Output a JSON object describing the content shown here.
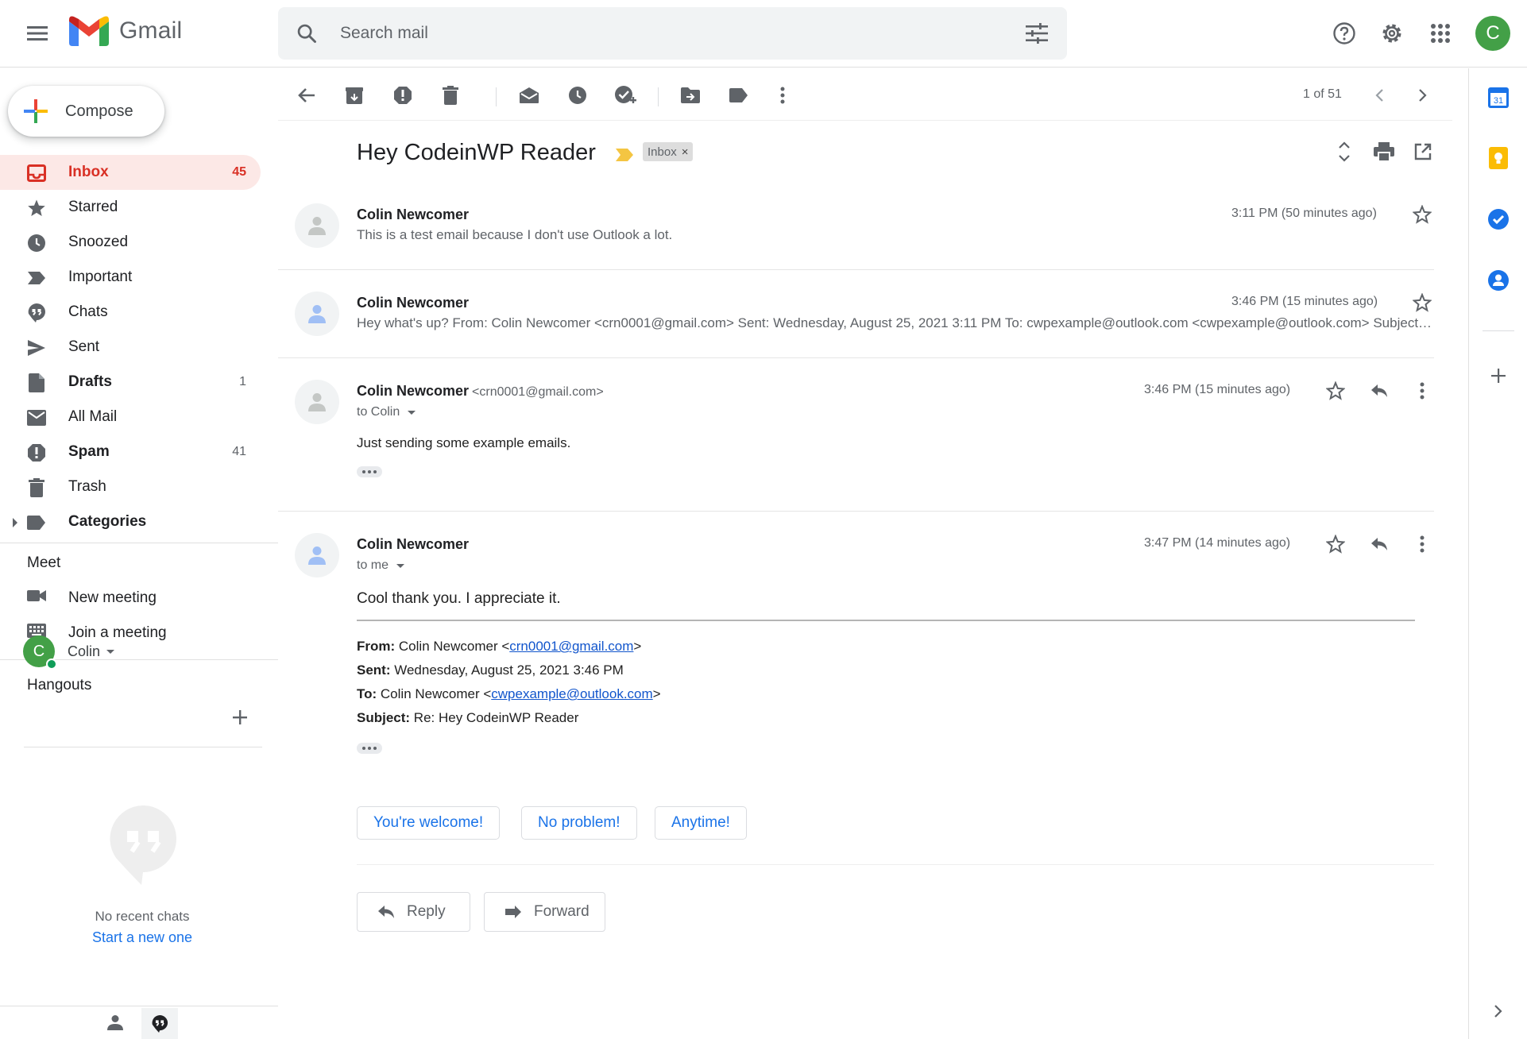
{
  "app": {
    "name": "Gmail"
  },
  "search": {
    "placeholder": "Search mail"
  },
  "user": {
    "initial": "C",
    "name": "Colin"
  },
  "compose": {
    "label": "Compose"
  },
  "nav": {
    "items": [
      {
        "label": "Inbox",
        "count": "45"
      },
      {
        "label": "Starred",
        "count": ""
      },
      {
        "label": "Snoozed",
        "count": ""
      },
      {
        "label": "Important",
        "count": ""
      },
      {
        "label": "Chats",
        "count": ""
      },
      {
        "label": "Sent",
        "count": ""
      },
      {
        "label": "Drafts",
        "count": "1"
      },
      {
        "label": "All Mail",
        "count": ""
      },
      {
        "label": "Spam",
        "count": "41"
      },
      {
        "label": "Trash",
        "count": ""
      },
      {
        "label": "Categories",
        "count": ""
      }
    ]
  },
  "meet": {
    "title": "Meet",
    "new_meeting": "New meeting",
    "join_meeting": "Join a meeting"
  },
  "hangouts": {
    "title": "Hangouts",
    "no_chats": "No recent chats",
    "start_new": "Start a new one"
  },
  "pager": {
    "text": "1 of 51"
  },
  "thread": {
    "subject": "Hey CodeinWP Reader",
    "label_chip": "Inbox",
    "label_chip_close": "×",
    "messages": [
      {
        "sender": "Colin Newcomer",
        "time": "3:11 PM (50 minutes ago)",
        "snippet": "This is a test email because I don't use Outlook a lot."
      },
      {
        "sender": "Colin Newcomer",
        "time": "3:46 PM (15 minutes ago)",
        "snippet": "Hey what's up? From: Colin Newcomer <crn0001@gmail.com> Sent: Wednesday, August 25, 2021 3:11 PM To: cwpexample@outlook.com <cwpexample@outlook.com> Subject: Hey CodeinWP Reader"
      },
      {
        "sender": "Colin Newcomer",
        "email": "<crn0001@gmail.com>",
        "time": "3:46 PM (15 minutes ago)",
        "to": "to Colin",
        "body": "Just sending some example emails."
      },
      {
        "sender": "Colin Newcomer",
        "time": "3:47 PM (14 minutes ago)",
        "to": "to me",
        "body": "Cool thank you. I appreciate it.",
        "quoted": {
          "from_label": "From:",
          "from_name": "Colin Newcomer <",
          "from_email": "crn0001@gmail.com",
          "from_end": ">",
          "sent_label": "Sent:",
          "sent_value": "Wednesday, August 25, 2021 3:46 PM",
          "to_label": "To:",
          "to_name": "Colin Newcomer <",
          "to_email": "cwpexample@outlook.com",
          "to_end": ">",
          "subject_label": "Subject:",
          "subject_value": "Re: Hey CodeinWP Reader"
        }
      }
    ]
  },
  "smart_replies": [
    "You're welcome!",
    "No problem!",
    "Anytime!"
  ],
  "actions": {
    "reply": "Reply",
    "forward": "Forward"
  },
  "calendar": {
    "day": "31"
  },
  "colors": {
    "accent": "#1a73e8",
    "active_bg": "#fce8e6",
    "active_text": "#d93025",
    "avatar": "#43a047"
  }
}
